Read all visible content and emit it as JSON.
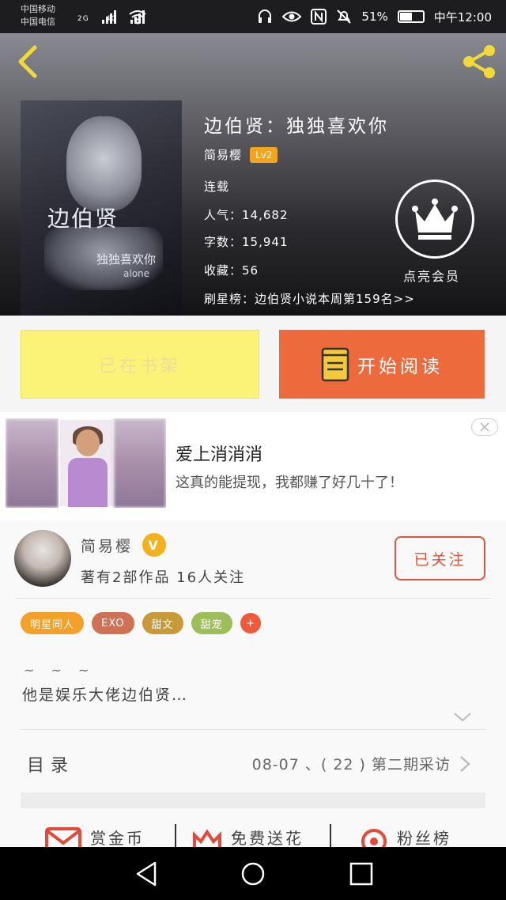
{
  "status_bar": {
    "carrier_1": "中国移动",
    "carrier_2": "中国电信",
    "net_1": "2G",
    "net_2": "4G",
    "battery": "51%",
    "time": "中午12:00"
  },
  "book": {
    "title": "边伯贤：独独喜欢你",
    "author": "简易樱",
    "level": "Lv2",
    "status": "连载",
    "popularity": "人气：14,682",
    "word_count": "字数：15,941",
    "favorites": "收藏：56",
    "ranking": "刷星榜：边伯贤小说本周第159名>>",
    "vip_label": "点亮会员",
    "cover_text": {
      "title": "边伯贤",
      "subtitle": "独独喜欢你",
      "caption": "alone"
    }
  },
  "actions": {
    "shelf_label": "已在书架",
    "read_label": "开始阅读"
  },
  "ad": {
    "title": "爱上消消消",
    "description": "这真的能提现，我都赚了好几十了！",
    "close_icon": "close-icon"
  },
  "author_section": {
    "name": "简易樱",
    "verified_badge": "V",
    "stats": "著有2部作品 16人关注",
    "follow_label": "已关注",
    "tags": [
      {
        "label": "明星同人",
        "color": "#f3a12a"
      },
      {
        "label": "EXO",
        "color": "#cf7154"
      },
      {
        "label": "甜文",
        "color": "#c99a3a"
      },
      {
        "label": "甜宠",
        "color": "#9cbf5a"
      }
    ],
    "tag_add": "+",
    "tilde": "~ ~ ~",
    "description": "他是娱乐大佬边伯贤…"
  },
  "toc": {
    "label": "目录",
    "latest": "08-07 、( 22 ) 第二期采访"
  },
  "bottom_actions": {
    "reward": "赏金币",
    "flowers": "免费送花",
    "fans": "粉丝榜"
  },
  "colors": {
    "accent_orange": "#ec6a3c",
    "shelf_yellow": "#fbf278",
    "badge_gold": "#f3a41f",
    "follow_red": "#d9553b"
  }
}
